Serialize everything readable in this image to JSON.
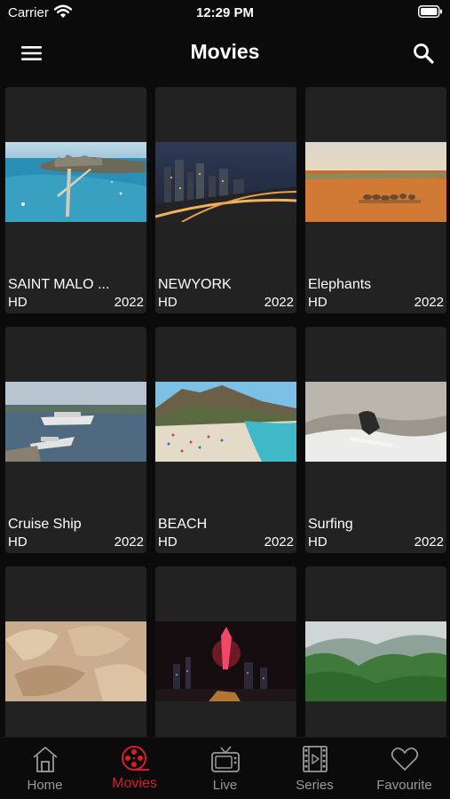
{
  "status": {
    "carrier": "Carrier",
    "time": "12:29 PM"
  },
  "header": {
    "title": "Movies"
  },
  "movies": [
    {
      "title": "SAINT MALO ...",
      "quality": "HD",
      "year": "2022"
    },
    {
      "title": "NEWYORK",
      "quality": "HD",
      "year": "2022"
    },
    {
      "title": "Elephants",
      "quality": "HD",
      "year": "2022"
    },
    {
      "title": "Cruise Ship",
      "quality": "HD",
      "year": "2022"
    },
    {
      "title": "BEACH",
      "quality": "HD",
      "year": "2022"
    },
    {
      "title": "Surfing",
      "quality": "HD",
      "year": "2022"
    },
    {
      "title": "",
      "quality": "",
      "year": ""
    },
    {
      "title": "",
      "quality": "",
      "year": ""
    },
    {
      "title": "",
      "quality": "",
      "year": ""
    }
  ],
  "tabs": [
    {
      "label": "Home",
      "icon": "home-icon"
    },
    {
      "label": "Movies",
      "icon": "film-reel-icon"
    },
    {
      "label": "Live",
      "icon": "tv-icon"
    },
    {
      "label": "Series",
      "icon": "film-strip-icon"
    },
    {
      "label": "Favourite",
      "icon": "heart-icon"
    }
  ],
  "colors": {
    "accent": "#d81e2a",
    "card": "#222222",
    "background": "#0b0b0b"
  }
}
